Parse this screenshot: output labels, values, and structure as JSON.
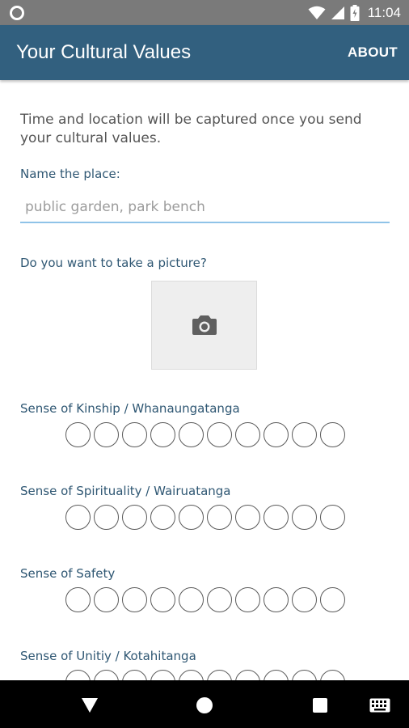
{
  "status_bar": {
    "time": "11:04",
    "icons": [
      "notification-ring-icon",
      "wifi-icon",
      "signal-icon",
      "battery-icon"
    ]
  },
  "app_bar": {
    "title": "Your Cultural Values",
    "about_label": "ABOUT",
    "color": "#32607f"
  },
  "form": {
    "intro_text": "Time and location will be captured once you send your cultural values.",
    "place_label": "Name the place:",
    "place_placeholder": "public garden, park bench",
    "place_value": "",
    "picture_label": "Do you want to take a picture?",
    "picture_icon": "camera-icon"
  },
  "value_scales": [
    {
      "label": "Sense of Kinship / Whanaungatanga",
      "options": 10,
      "selected": null
    },
    {
      "label": "Sense of Spirituality / Wairuatanga",
      "options": 10,
      "selected": null
    },
    {
      "label": "Sense of Safety",
      "options": 10,
      "selected": null
    },
    {
      "label": "Sense of Unitiy / Kotahitanga",
      "options": 10,
      "selected": null
    }
  ],
  "nav_bar": {
    "icons": [
      "back-icon",
      "home-icon",
      "recents-icon",
      "keyboard-icon"
    ]
  }
}
